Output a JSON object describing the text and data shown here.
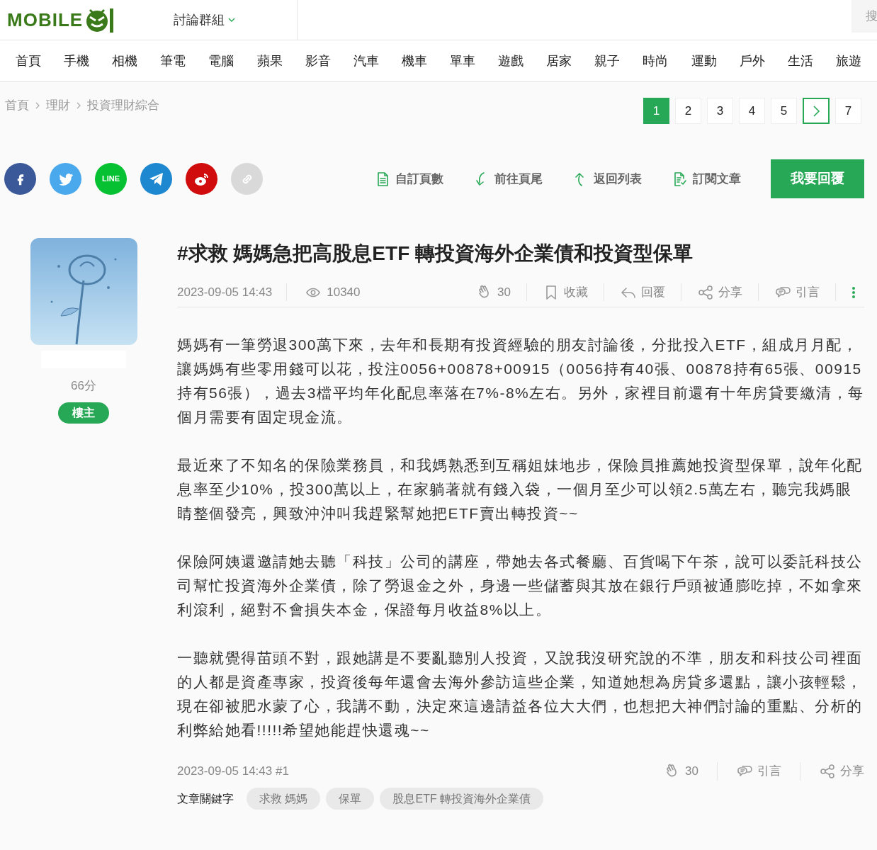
{
  "header": {
    "logo": "MOBILE",
    "forum_menu": "討論群組",
    "search": "搜"
  },
  "nav": [
    "首頁",
    "手機",
    "相機",
    "筆電",
    "電腦",
    "蘋果",
    "影音",
    "汽車",
    "機車",
    "單車",
    "遊戲",
    "居家",
    "親子",
    "時尚",
    "運動",
    "戶外",
    "生活",
    "旅遊"
  ],
  "breadcrumb": [
    "首頁",
    "理財",
    "投資理財綜合"
  ],
  "pagination": [
    {
      "kind": "page",
      "label": "1",
      "selected": true
    },
    {
      "kind": "page",
      "label": "2",
      "selected": false
    },
    {
      "kind": "page",
      "label": "3",
      "selected": false
    },
    {
      "kind": "page",
      "label": "4",
      "selected": false
    },
    {
      "kind": "page",
      "label": "5",
      "selected": false
    },
    {
      "kind": "next",
      "selected": false
    },
    {
      "kind": "page",
      "label": "7",
      "selected": false
    }
  ],
  "share": [
    {
      "kind": "facebook"
    },
    {
      "kind": "twitter"
    },
    {
      "kind": "line",
      "label": "LINE"
    },
    {
      "kind": "telegram"
    },
    {
      "kind": "weibo"
    },
    {
      "kind": "link"
    }
  ],
  "toolbar": [
    {
      "kind": "pages",
      "label": "自訂頁數"
    },
    {
      "kind": "bottom",
      "label": "前往頁尾"
    },
    {
      "kind": "back",
      "label": "返回列表"
    },
    {
      "kind": "subscribe",
      "label": "訂閱文章"
    }
  ],
  "reply_button": "我要回覆",
  "author": {
    "score": "66分",
    "badge": "樓主"
  },
  "post": {
    "title": "#求救 媽媽急把高股息ETF 轉投資海外企業債和投資型保單",
    "date": "2023-09-05 14:43",
    "views": "10340",
    "actions": [
      {
        "kind": "like",
        "label": "30"
      },
      {
        "kind": "bookmark",
        "label": "收藏"
      },
      {
        "kind": "reply",
        "label": "回覆"
      },
      {
        "kind": "share",
        "label": "分享"
      },
      {
        "kind": "quote",
        "label": "引言"
      }
    ],
    "paragraphs": [
      "媽媽有一筆勞退300萬下來，去年和長期有投資經驗的朋友討論後，分批投入ETF，組成月月配，讓媽媽有些零用錢可以花，投注0056+00878+00915（0056持有40張、00878持有65張、00915持有56張），過去3檔平均年化配息率落在7%-8%左右。另外，家裡目前還有十年房貸要繳清，每個月需要有固定現金流。",
      "最近來了不知名的保險業務員，和我媽熟悉到互稱姐妹地步，保險員推薦她投資型保單，說年化配息率至少10%，投300萬以上，在家躺著就有錢入袋，一個月至少可以領2.5萬左右，聽完我媽眼睛整個發亮，興致沖沖叫我趕緊幫她把ETF賣出轉投資~~",
      "保險阿姨還邀請她去聽「科技」公司的講座，帶她去各式餐廳、百貨喝下午茶，說可以委託科技公司幫忙投資海外企業債，除了勞退金之外，身邊一些儲蓄與其放在銀行戶頭被通膨吃掉，不如拿來利滾利，絕對不會損失本金，保證每月收益8%以上。",
      "一聽就覺得苗頭不對，跟她講是不要亂聽別人投資，又說我沒研究說的不準，朋友和科技公司裡面的人都是資產專家，投資後每年還會去海外參訪這些企業，知道她想為房貸多還點，讓小孩輕鬆，現在卻被肥水蒙了心，我講不動，決定來這邊請益各位大大們，也想把大神們討論的重點、分析的利弊給她看!!!!!希望她能趕快還魂~~"
    ],
    "footer_meta": "2023-09-05 14:43 #1",
    "footer_actions": [
      {
        "kind": "like",
        "label": "30"
      },
      {
        "kind": "quote",
        "label": "引言"
      },
      {
        "kind": "share",
        "label": "分享"
      }
    ],
    "keywords_label": "文章關鍵字",
    "keywords": [
      "求救 媽媽",
      "保單",
      "股息ETF 轉投資海外企業債"
    ]
  }
}
